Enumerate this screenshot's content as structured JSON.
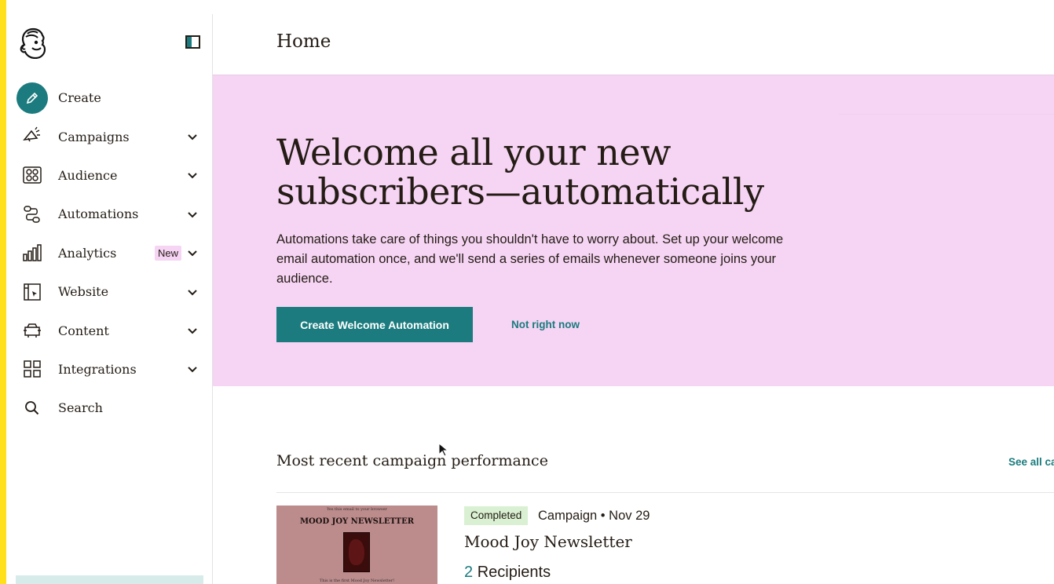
{
  "colors": {
    "accent": "#1b7b7e",
    "banner_bg": "#f6d5f4",
    "yellow_strip": "#ffe01b",
    "status_completed_bg": "#d9f0d2"
  },
  "sidebar": {
    "logo_icon": "mailchimp-freddie-logo",
    "collapse_icon": "sidebar-collapse-icon",
    "items": [
      {
        "label": "Create",
        "icon": "pencil-icon"
      },
      {
        "label": "Campaigns",
        "icon": "megaphone-icon"
      },
      {
        "label": "Audience",
        "icon": "audience-icon"
      },
      {
        "label": "Automations",
        "icon": "automations-icon"
      },
      {
        "label": "Analytics",
        "icon": "bar-chart-icon",
        "badge": "New"
      },
      {
        "label": "Website",
        "icon": "website-icon"
      },
      {
        "label": "Content",
        "icon": "content-icon"
      },
      {
        "label": "Integrations",
        "icon": "grid-icon"
      },
      {
        "label": "Search",
        "icon": "search-icon"
      }
    ]
  },
  "header": {
    "title": "Home"
  },
  "banner": {
    "heading": "Welcome all your new subscribers—automatically",
    "body": "Automations take care of things you shouldn't have to worry about. Set up your welcome email automation once, and we'll send a series of emails whenever someone joins your audience.",
    "primary_button": "Create Welcome Automation",
    "secondary_link": "Not right now"
  },
  "recent": {
    "title": "Most recent campaign performance",
    "see_all": "See all ca",
    "campaign": {
      "status": "Completed",
      "meta": "Campaign • Nov 29",
      "name": "Mood Joy Newsletter",
      "recipients_count": "2",
      "recipients_label": "Recipients",
      "thumbnail": {
        "top_text": "Yes this email to your browser",
        "title": "MOOD JOY NEWSLETTER",
        "bottom_text": "This is the first Mood Joy Newsletter!"
      }
    }
  }
}
